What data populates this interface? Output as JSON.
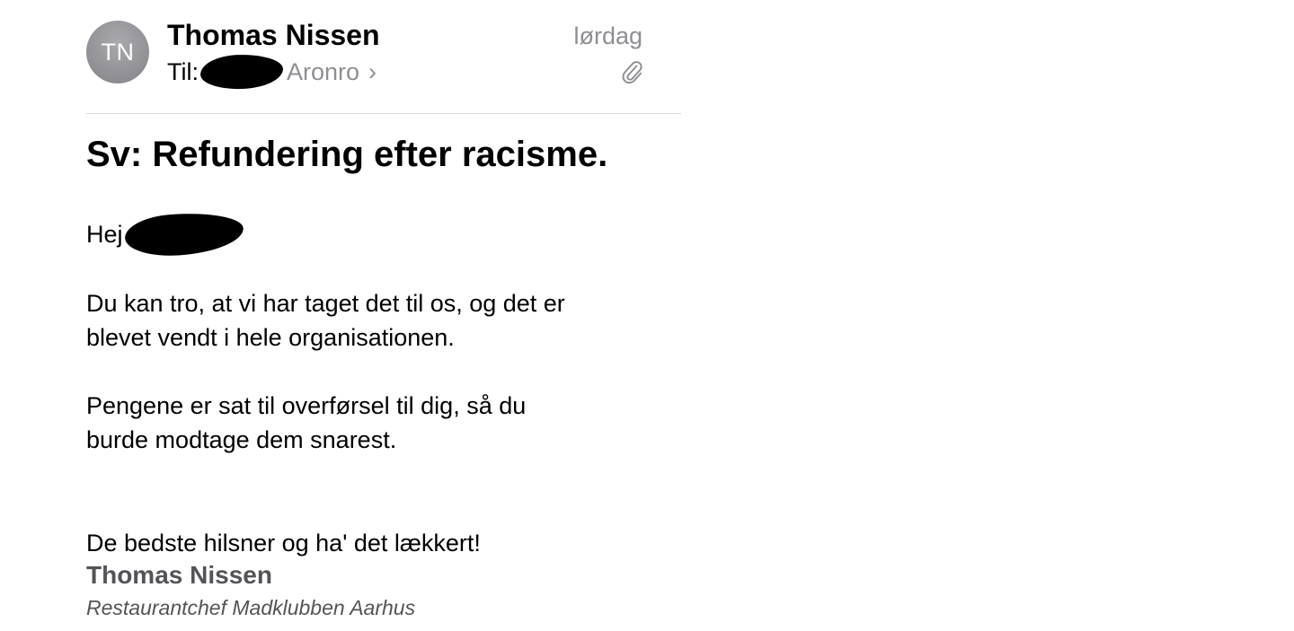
{
  "header": {
    "avatar_initials": "TN",
    "sender_name": "Thomas Nissen",
    "date": "lørdag",
    "to_label": "Til:",
    "recipient": "Aronro",
    "chevron": "›",
    "attachment_icon": "paperclip-icon"
  },
  "message": {
    "subject": "Sv: Refundering efter racisme.",
    "greeting": "Hej",
    "paragraph1_line1": "Du kan tro, at vi har taget det til os, og det er",
    "paragraph1_line2": "blevet vendt i hele organisationen.",
    "paragraph2_line1": "Pengene er sat til overførsel til dig, så du",
    "paragraph2_line2": "burde modtage dem snarest.",
    "closing": "De bedste hilsner og ha' det lækkert!"
  },
  "signature": {
    "name": "Thomas Nissen",
    "title": "Restaurantchef Madklubben Aarhus"
  },
  "colors": {
    "avatar_bg": "#8e8e93",
    "secondary_text": "#8e8e93",
    "signature_text": "#545458",
    "divider": "#d8d8dc"
  }
}
